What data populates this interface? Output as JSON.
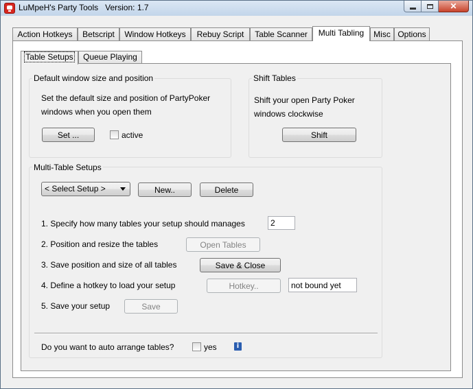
{
  "window": {
    "title": "LuMpeH's Party Tools   Version: 1.7",
    "minimize_glyph": "",
    "maximize_glyph": "",
    "close_glyph": "✕"
  },
  "tabs": [
    {
      "label": "Action Hotkeys"
    },
    {
      "label": "Betscript"
    },
    {
      "label": "Window Hotkeys"
    },
    {
      "label": "Rebuy Script"
    },
    {
      "label": "Table Scanner"
    },
    {
      "label": "Multi Tabling"
    },
    {
      "label": "Misc"
    },
    {
      "label": "Options"
    }
  ],
  "subtabs": [
    {
      "label": "Table Setups"
    },
    {
      "label": "Queue Playing"
    }
  ],
  "default_window": {
    "title": "Default window size and position",
    "description_line1": "Set the default size and position of PartyPoker",
    "description_line2": "windows when you open them",
    "set_button": "Set ...",
    "active_label": "active"
  },
  "shift_tables": {
    "title": "Shift Tables",
    "description_line1": "Shift your open Party Poker",
    "description_line2": "windows clockwise",
    "shift_button": "Shift"
  },
  "multi_table": {
    "title": "Multi-Table Setups",
    "select_value": "< Select Setup >",
    "new_button": "New..",
    "delete_button": "Delete",
    "step1_label": "1. Specify how many tables your setup should manages",
    "step1_value": "2",
    "step2_label": "2. Position and resize the tables",
    "open_tables_button": "Open Tables",
    "step3_label": "3. Save position and size of all tables",
    "save_close_button": "Save & Close",
    "step4_label": "4. Define a hotkey to load your setup",
    "hotkey_button": "Hotkey..",
    "hotkey_value": "not bound yet",
    "step5_label": "5. Save your setup",
    "save_button": "Save",
    "auto_arrange_label": "Do you want to auto arrange tables?",
    "yes_label": "yes",
    "info_glyph": "i"
  }
}
